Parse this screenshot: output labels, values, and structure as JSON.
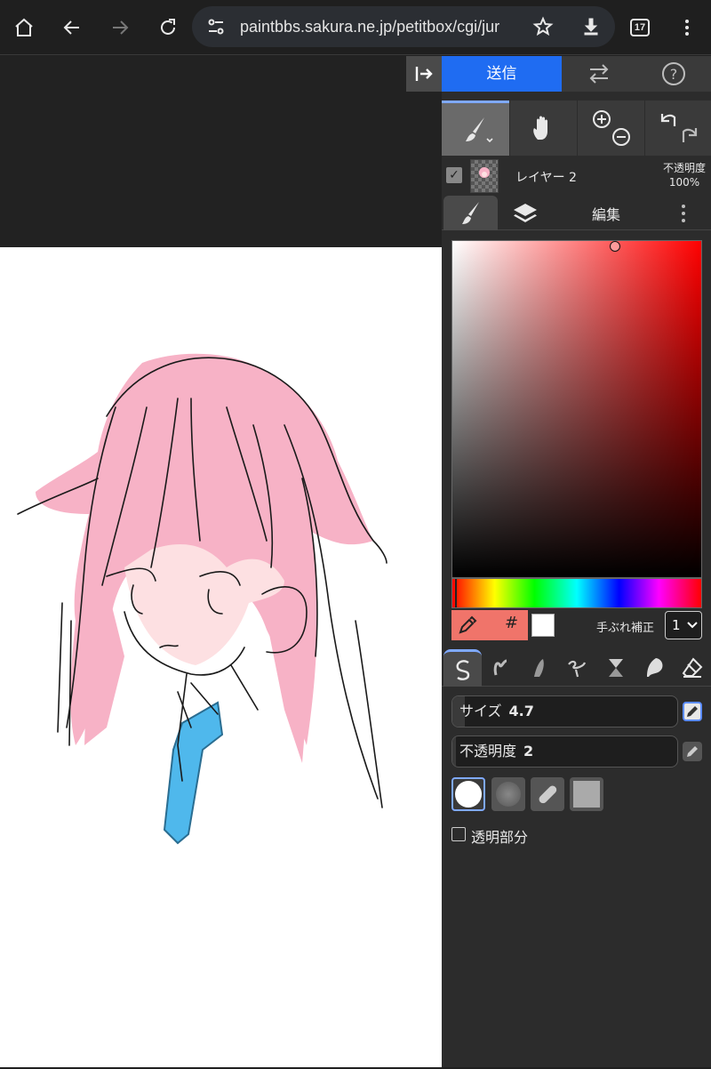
{
  "browser": {
    "url": "paintbbs.sakura.ne.jp/petitbox/cgi/jur",
    "tab_count": "17"
  },
  "panel": {
    "send_label": "送信",
    "layer": {
      "name": "レイヤー 2",
      "opacity_label": "不透明度",
      "opacity_value": "100%"
    },
    "tabs": {
      "edit_label": "編集"
    },
    "color": {
      "current_hex": "#f0746a",
      "secondary_hex": "#ffffff",
      "hash_label": "#"
    },
    "stabilizer": {
      "label": "手ぶれ補正",
      "value": "1"
    },
    "size": {
      "label": "サイズ",
      "value": "4.7"
    },
    "opacity": {
      "label": "不透明度",
      "value": "2"
    },
    "transparent": {
      "label": "透明部分"
    }
  },
  "colors": {
    "accent_blue": "#1f6cf2",
    "hair_pink": "#f7b2c6",
    "tie_blue": "#4fb8ec"
  }
}
